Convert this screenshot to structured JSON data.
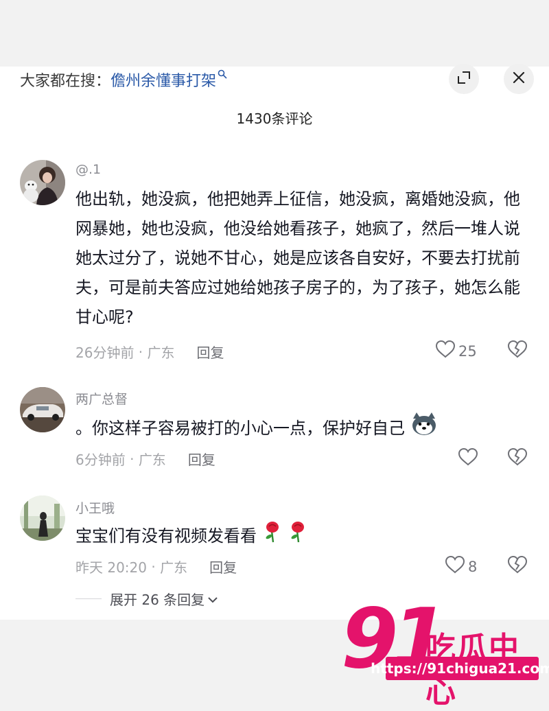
{
  "search": {
    "prefix": "大家都在搜：",
    "query": "儋州余懂事打架"
  },
  "header": {
    "comment_count": "1430条评论"
  },
  "comments": [
    {
      "author": "@.1",
      "text": "他出轨，她没疯，他把她弄上征信，她没疯，离婚她没疯，他网暴她，她也没疯，他没给她看孩子，她疯了，然后一堆人说她太过分了，说她不甘心，她是应该各自安好，不要去打扰前夫，可是前夫答应过她给她孩子房子的，为了孩子，她怎么能甘心呢?",
      "time": "26分钟前",
      "location": "广东",
      "reply_label": "回复",
      "likes": "25"
    },
    {
      "author": "两广总督",
      "text": "。你这样子容易被打的小心一点，保护好自己",
      "time": "6分钟前",
      "location": "广东",
      "reply_label": "回复",
      "likes": ""
    },
    {
      "author": "小王哦",
      "text": "宝宝们有没有视频发看看",
      "time": "昨天 20:20",
      "location": "广东",
      "reply_label": "回复",
      "likes": "8"
    }
  ],
  "replies": {
    "expand_label": "展开 26 条回复"
  },
  "watermark": {
    "logo_number": "91",
    "logo_text": "吃瓜中心",
    "url": "https://91chigua21.com"
  },
  "colors": {
    "accent_link": "#2b5aa8",
    "watermark": "#e4136b",
    "text_primary": "#161823",
    "text_secondary": "#8a8b91"
  }
}
